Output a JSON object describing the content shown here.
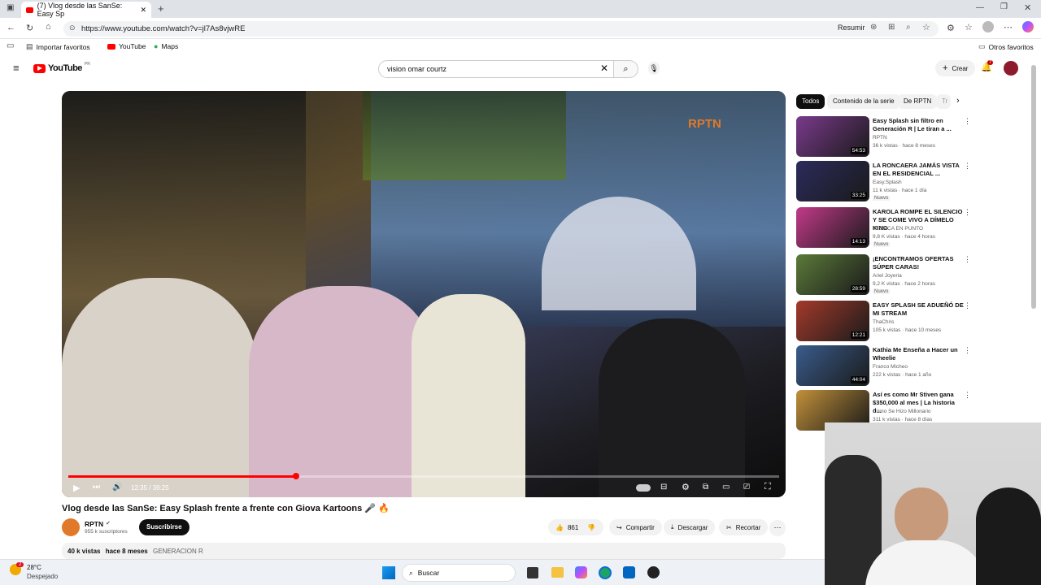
{
  "browser": {
    "tab_title": "(7) Vlog desde las SanSe: Easy Sp",
    "url": "https://www.youtube.com/watch?v=jl7As8vjwRE",
    "summarize_label": "Resumir",
    "bookmarks": [
      {
        "label": "Importar favoritos",
        "icon": "bookmark-import-icon"
      },
      {
        "label": "YouTube",
        "icon": "youtube-icon"
      },
      {
        "label": "Maps",
        "icon": "maps-pin-icon"
      }
    ],
    "other_favorites": "Otros favoritos"
  },
  "youtube": {
    "logo_text": "YouTube",
    "logo_region": "PR",
    "search_value": "vision omar courtz",
    "create_label": "Crear",
    "notification_count": "7"
  },
  "video": {
    "watermark": "RPTN",
    "time": "12:35 / 39:25",
    "progress": 0.32,
    "title": "Vlog desde las SanSe: Easy Splash frente a frente con Giova Kartoons 🎤 🔥",
    "channel_name": "RPTN",
    "subscribers": "955 k suscriptores",
    "subscribe_label": "Suscribirse",
    "likes": "861",
    "share_label": "Compartir",
    "download_label": "Descargar",
    "clip_label": "Recortar",
    "views": "40 k vistas",
    "date": "hace 8 meses",
    "tag": "GENERACION R"
  },
  "sidebar": {
    "chips": [
      "Todos",
      "Contenido de la serie",
      "De RPTN",
      "Tr"
    ],
    "recommendations": [
      {
        "title": "Easy Splash sin filtro en Generación R | Le tiran a ...",
        "channel": "RPTN",
        "meta": "36 k vistas · hace 8 meses",
        "duration": "54:53",
        "badge": "",
        "color": "#7a3a8c"
      },
      {
        "title": "LA RONCAERA JAMÁS VISTA EN EL RESIDENCIAL ...",
        "channel": "Easy.Splash",
        "meta": "11 k vistas · hace 1 día",
        "duration": "33:25",
        "badge": "Nuevo",
        "color": "#2b2b5c"
      },
      {
        "title": "KAROLA ROMPE EL SILENCIO Y SE COME VIVO A DÍMELO KING",
        "channel": "JESSICA EN PUNTO",
        "meta": "9,8 K vistas · hace 4 horas",
        "duration": "14:13",
        "badge": "Nuevo",
        "color": "#c23a8a"
      },
      {
        "title": "¡ENCONTRAMOS OFERTAS SÚPER CARAS!",
        "channel": "Ariel Joyeria",
        "meta": "9,2 K vistas · hace 2 horas",
        "duration": "28:59",
        "badge": "Nuevo",
        "color": "#5c7a3a"
      },
      {
        "title": "EASY SPLASH SE ADUEÑÓ DE MI STREAM",
        "channel": "ThaChris",
        "meta": "105 k vistas · hace 10 meses",
        "duration": "12:21",
        "badge": "",
        "color": "#a33a2b"
      },
      {
        "title": "Kathia Me Enseña a Hacer un Wheelie",
        "channel": "Franco Micheo",
        "meta": "222 k vistas · hace 1 año",
        "duration": "44:04",
        "badge": "",
        "color": "#3a5c8c"
      },
      {
        "title": "Así es como Mr Stiven gana $350,000 al mes | La historia d...",
        "channel": "Cómo Se Hizo Millonario",
        "meta": "311 k vistas · hace 8 días",
        "duration": "",
        "badge": "",
        "color": "#c2913a"
      }
    ]
  },
  "taskbar": {
    "weather_temp": "28°C",
    "weather_desc": "Despejado",
    "weather_badge": "2",
    "search_label": "Buscar"
  }
}
